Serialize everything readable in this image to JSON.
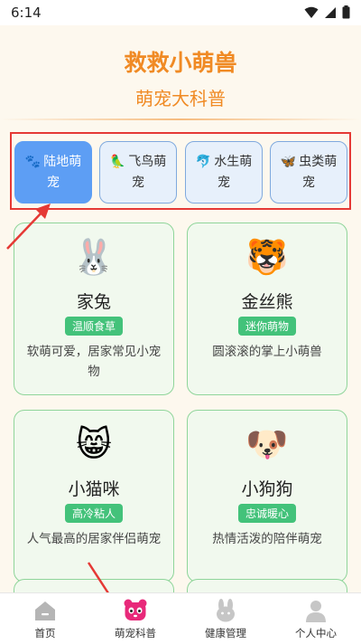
{
  "status": {
    "time": "6:14"
  },
  "header": {
    "title": "救救小萌兽",
    "subtitle": "萌宠大科普"
  },
  "tabs": [
    {
      "emoji": "🐾",
      "label": "陆地萌宠",
      "active": true
    },
    {
      "emoji": "🦜",
      "label": "飞鸟萌宠",
      "active": false
    },
    {
      "emoji": "🐬",
      "label": "水生萌宠",
      "active": false
    },
    {
      "emoji": "🦋",
      "label": "虫类萌宠",
      "active": false
    }
  ],
  "cards": [
    {
      "emoji": "🐰",
      "name": "家兔",
      "tag": "温顺食草",
      "desc": "软萌可爱，居家常见小宠物"
    },
    {
      "emoji": "🐯",
      "name": "金丝熊",
      "tag": "迷你萌物",
      "desc": "圆滚滚的掌上小萌兽"
    },
    {
      "emoji": "😸",
      "name": "小猫咪",
      "tag": "高冷粘人",
      "desc": "人气最高的居家伴侣萌宠"
    },
    {
      "emoji": "🐶",
      "name": "小狗狗",
      "tag": "忠诚暖心",
      "desc": "热情活泼的陪伴萌宠"
    }
  ],
  "bottom_nav": [
    {
      "label": "首页",
      "icon": "home-icon"
    },
    {
      "label": "萌宠科普",
      "icon": "panda-icon",
      "active": true
    },
    {
      "label": "健康管理",
      "icon": "bunny-icon"
    },
    {
      "label": "个人中心",
      "icon": "person-icon"
    }
  ],
  "colors": {
    "accent": "#f08a24",
    "tab_active": "#5d9ef4",
    "tag_green": "#43c27a",
    "nav_active": "#e8297a",
    "annotation": "#e53935"
  }
}
